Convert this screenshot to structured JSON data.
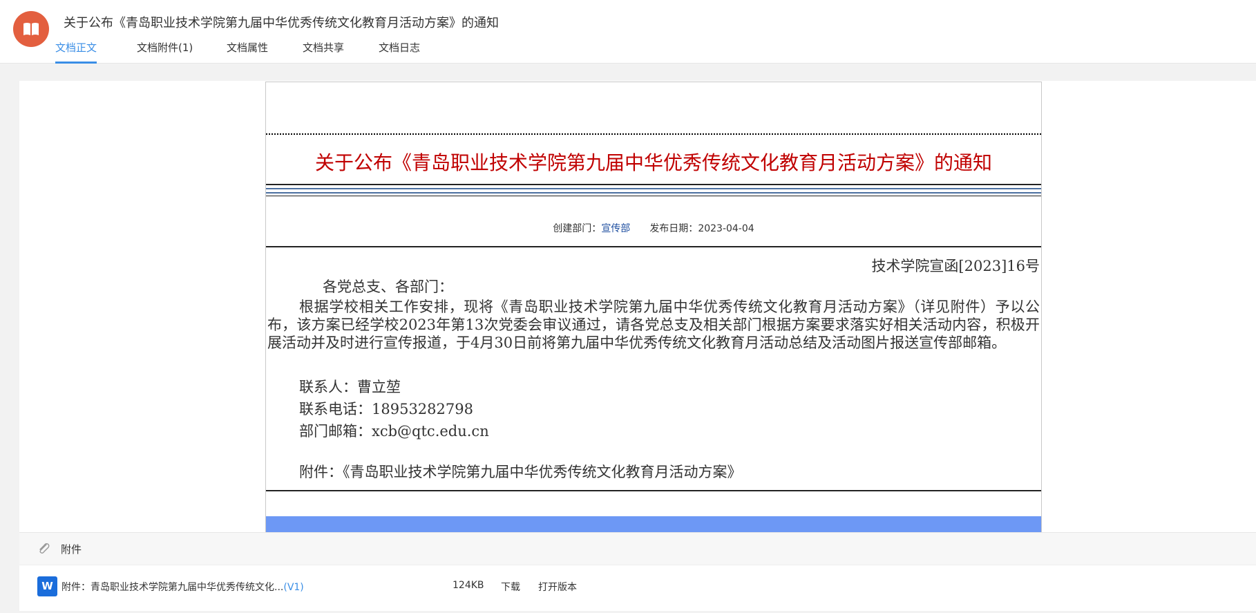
{
  "header": {
    "title": "关于公布《青岛职业技术学院第九届中华优秀传统文化教育月活动方案》的通知",
    "logo_icon": "open-book-icon",
    "accent_color": "#e35f3f"
  },
  "tabs": [
    {
      "label": "文档正文",
      "active": true
    },
    {
      "label": "文档附件(1)",
      "active": false
    },
    {
      "label": "文档属性",
      "active": false
    },
    {
      "label": "文档共享",
      "active": false
    },
    {
      "label": "文档日志",
      "active": false
    }
  ],
  "document": {
    "title": "关于公布《青岛职业技术学院第九届中华优秀传统文化教育月活动方案》的通知",
    "title_color": "#c00000",
    "meta": {
      "dept_label": "创建部门：",
      "dept_value": "宣传部",
      "date_label": "发布日期：",
      "date_value": "2023-04-04"
    },
    "doc_number": "技术学院宣函[2023]16号",
    "greeting": "各党总支、各部门：",
    "body": "根据学校相关工作安排，现将《青岛职业技术学院第九届中华优秀传统文化教育月活动方案》（详见附件）予以公布，该方案已经学校2023年第13次党委会审议通过，请各党总支及相关部门根据方案要求落实好相关活动内容，积极开展活动并及时进行宣传报道，于4月30日前将第九届中华优秀传统文化教育月活动总结及活动图片报送宣传部邮箱。",
    "contact": "联系人：曹立堃",
    "phone": "联系电话：18953282798",
    "email": "部门邮箱：xcb@qtc.edu.cn",
    "attachment_line": "附件：《青岛职业技术学院第九届中华优秀传统文化教育月活动方案》"
  },
  "attachments": {
    "header_label": "附件",
    "header_icon": "paperclip-icon",
    "files": [
      {
        "icon": "word-file-icon",
        "icon_letter": "W",
        "name": "附件：青岛职业技术学院第九届中华优秀传统文化...",
        "version": "(V1)",
        "size": "124KB",
        "download_label": "下载",
        "open_label": "打开版本"
      }
    ]
  }
}
